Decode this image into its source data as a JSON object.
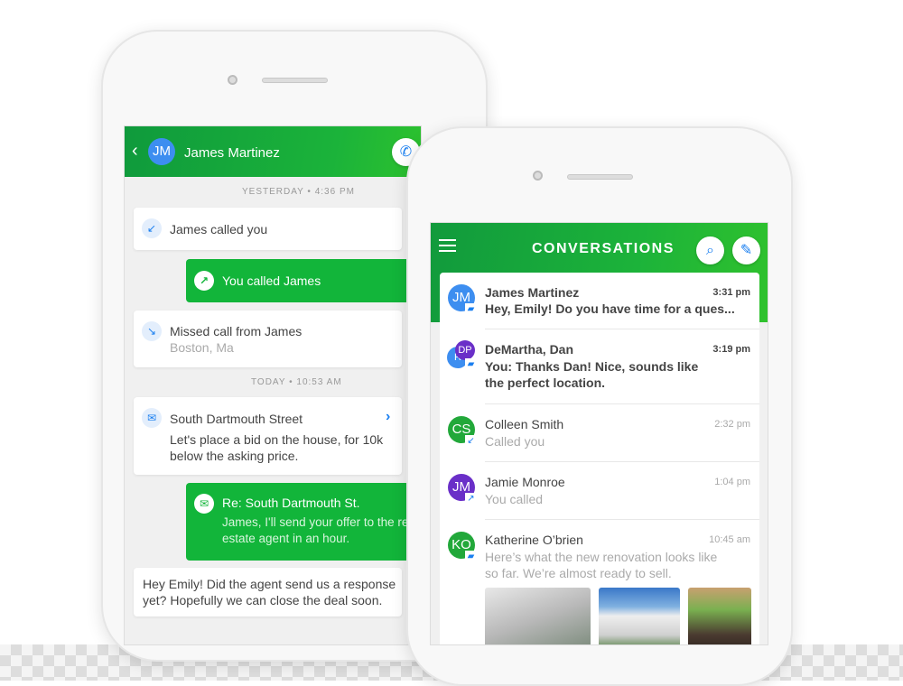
{
  "chat": {
    "contact_name": "James Martinez",
    "contact_initials": "JM",
    "back_icon": "chevron-left-icon",
    "call_icon": "phone-icon",
    "stamp_yesterday": "YESTERDAY • 4:36 PM",
    "stamp_today": "TODAY • 10:53 AM",
    "messages": [
      {
        "text": "James called you",
        "icon": "incoming-call-icon"
      },
      {
        "text": "You called James",
        "icon": "outgoing-call-icon"
      },
      {
        "text": "Missed call from James",
        "sub": "Boston, Ma",
        "icon": "missed-call-icon"
      },
      {
        "title": "South Dartmouth Street",
        "text": "Let's place a bid on the house, for 10k below the asking price.",
        "icon": "email-icon"
      },
      {
        "title": "Re: South Dartmouth St.",
        "text": "James, I'll send your offer to the real estate agent in an hour.",
        "icon": "email-icon"
      },
      {
        "text": "Hey Emily! Did the agent send us a response yet? Hopefully we can close the deal soon."
      }
    ]
  },
  "conversations": {
    "title": "CONVERSATIONS",
    "items": [
      {
        "initials": "JM",
        "name": "James Martinez",
        "time": "3:31 pm",
        "message": "Hey, Emily! Do you have time for a ques...",
        "color": "#3d8ef0",
        "unread": true,
        "type": "message"
      },
      {
        "initials": "DP",
        "initials2": "R",
        "name": "DeMartha, Dan",
        "time": "3:19 pm",
        "message": "You: Thanks Dan! Nice, sounds like the perfect location.",
        "color": "#6a2fc8",
        "unread": true,
        "type": "message"
      },
      {
        "initials": "CS",
        "name": "Colleen Smith",
        "time": "2:32 pm",
        "message": "Called you",
        "color": "#22a83a",
        "unread": false,
        "type": "incoming-call"
      },
      {
        "initials": "JM",
        "name": "Jamie Monroe",
        "time": "1:04 pm",
        "message": "You called",
        "color": "#6a2fc8",
        "unread": false,
        "type": "outgoing-call"
      },
      {
        "initials": "KO",
        "name": "Katherine O’brien",
        "time": "10:45 am",
        "message": "Here’s what the new renovation looks like so far. We’re almost ready to sell.",
        "color": "#22a83a",
        "unread": false,
        "type": "message"
      }
    ]
  },
  "colors": {
    "brand_green": "#12b53a",
    "accent_blue": "#1a7ff0"
  }
}
